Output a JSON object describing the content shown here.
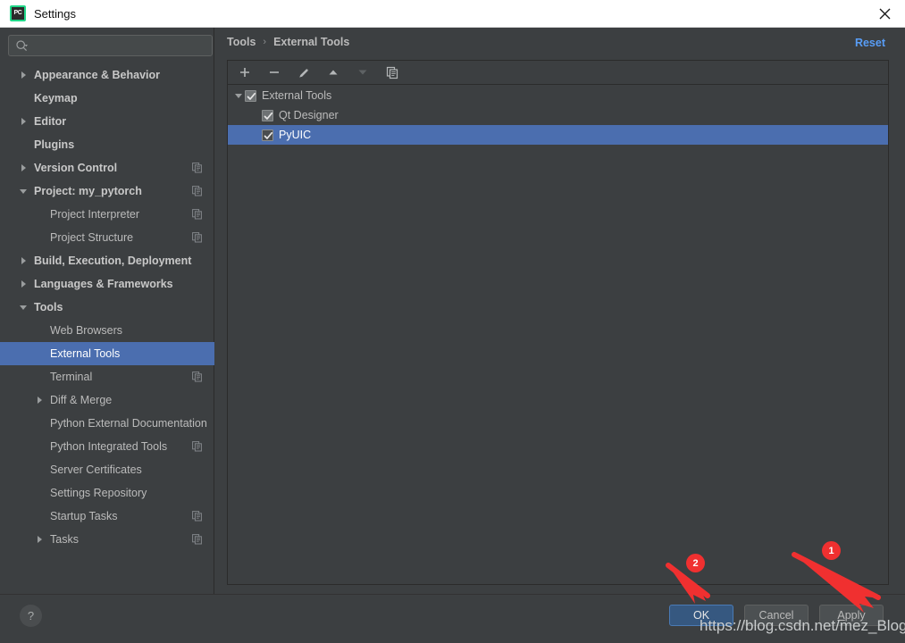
{
  "window": {
    "title": "Settings",
    "app_icon": "pycharm-icon",
    "app_icon_text": "PC",
    "close_icon": "close-icon",
    "accent_green": "#21d789",
    "accent_blue": "#4b6eaf",
    "bg": "#3c3f41"
  },
  "search": {
    "value": "",
    "placeholder": "",
    "icon": "search-icon"
  },
  "sidebar": {
    "items": [
      {
        "label": "Appearance & Behavior",
        "indent": 0,
        "arrow": "right",
        "bold": true,
        "copy": false,
        "selected": false
      },
      {
        "label": "Keymap",
        "indent": 0,
        "arrow": "none",
        "bold": true,
        "copy": false,
        "selected": false
      },
      {
        "label": "Editor",
        "indent": 0,
        "arrow": "right",
        "bold": true,
        "copy": false,
        "selected": false
      },
      {
        "label": "Plugins",
        "indent": 0,
        "arrow": "none",
        "bold": true,
        "copy": false,
        "selected": false
      },
      {
        "label": "Version Control",
        "indent": 0,
        "arrow": "right",
        "bold": true,
        "copy": true,
        "selected": false
      },
      {
        "label": "Project: my_pytorch",
        "indent": 0,
        "arrow": "down",
        "bold": true,
        "copy": true,
        "selected": false
      },
      {
        "label": "Project Interpreter",
        "indent": 1,
        "arrow": "none",
        "bold": false,
        "copy": true,
        "selected": false
      },
      {
        "label": "Project Structure",
        "indent": 1,
        "arrow": "none",
        "bold": false,
        "copy": true,
        "selected": false
      },
      {
        "label": "Build, Execution, Deployment",
        "indent": 0,
        "arrow": "right",
        "bold": true,
        "copy": false,
        "selected": false
      },
      {
        "label": "Languages & Frameworks",
        "indent": 0,
        "arrow": "right",
        "bold": true,
        "copy": false,
        "selected": false
      },
      {
        "label": "Tools",
        "indent": 0,
        "arrow": "down",
        "bold": true,
        "copy": false,
        "selected": false
      },
      {
        "label": "Web Browsers",
        "indent": 1,
        "arrow": "none",
        "bold": false,
        "copy": false,
        "selected": false
      },
      {
        "label": "External Tools",
        "indent": 1,
        "arrow": "none",
        "bold": false,
        "copy": false,
        "selected": true
      },
      {
        "label": "Terminal",
        "indent": 1,
        "arrow": "none",
        "bold": false,
        "copy": true,
        "selected": false
      },
      {
        "label": "Diff & Merge",
        "indent": 1,
        "arrow": "right",
        "bold": false,
        "copy": false,
        "selected": false
      },
      {
        "label": "Python External Documentation",
        "indent": 1,
        "arrow": "none",
        "bold": false,
        "copy": false,
        "selected": false
      },
      {
        "label": "Python Integrated Tools",
        "indent": 1,
        "arrow": "none",
        "bold": false,
        "copy": true,
        "selected": false
      },
      {
        "label": "Server Certificates",
        "indent": 1,
        "arrow": "none",
        "bold": false,
        "copy": false,
        "selected": false
      },
      {
        "label": "Settings Repository",
        "indent": 1,
        "arrow": "none",
        "bold": false,
        "copy": false,
        "selected": false
      },
      {
        "label": "Startup Tasks",
        "indent": 1,
        "arrow": "none",
        "bold": false,
        "copy": true,
        "selected": false
      },
      {
        "label": "Tasks",
        "indent": 1,
        "arrow": "right",
        "bold": false,
        "copy": true,
        "selected": false
      }
    ]
  },
  "main": {
    "breadcrumb": {
      "parent": "Tools",
      "separator": "›",
      "current": "External Tools"
    },
    "reset_label": "Reset",
    "toolbar": [
      {
        "name": "add-button",
        "icon": "plus-icon",
        "enabled": true
      },
      {
        "name": "remove-button",
        "icon": "minus-icon",
        "enabled": true
      },
      {
        "name": "edit-button",
        "icon": "pencil-icon",
        "enabled": true
      },
      {
        "name": "move-up-button",
        "icon": "arrow-up-icon",
        "enabled": true
      },
      {
        "name": "move-down-button",
        "icon": "arrow-down-icon",
        "enabled": false
      },
      {
        "name": "copy-button",
        "icon": "copy-icon",
        "enabled": true
      }
    ],
    "tree": [
      {
        "label": "External Tools",
        "indent": 0,
        "arrow": "down",
        "checked": true,
        "selected": false
      },
      {
        "label": "Qt Designer",
        "indent": 1,
        "arrow": "none",
        "checked": true,
        "selected": false
      },
      {
        "label": "PyUIC",
        "indent": 1,
        "arrow": "none",
        "checked": true,
        "selected": true
      }
    ]
  },
  "footer": {
    "help_label": "?",
    "ok_label": "OK",
    "cancel_label": "Cancel",
    "apply_label": "Apply",
    "apply_mnemonic": "A",
    "apply_rest": "pply"
  },
  "annotations": {
    "badges": [
      {
        "text": "1",
        "target": "apply-button"
      },
      {
        "text": "2",
        "target": "ok-button"
      }
    ],
    "color": "#f03030",
    "watermark": "https://blog.csdn.net/mez_Blog"
  }
}
